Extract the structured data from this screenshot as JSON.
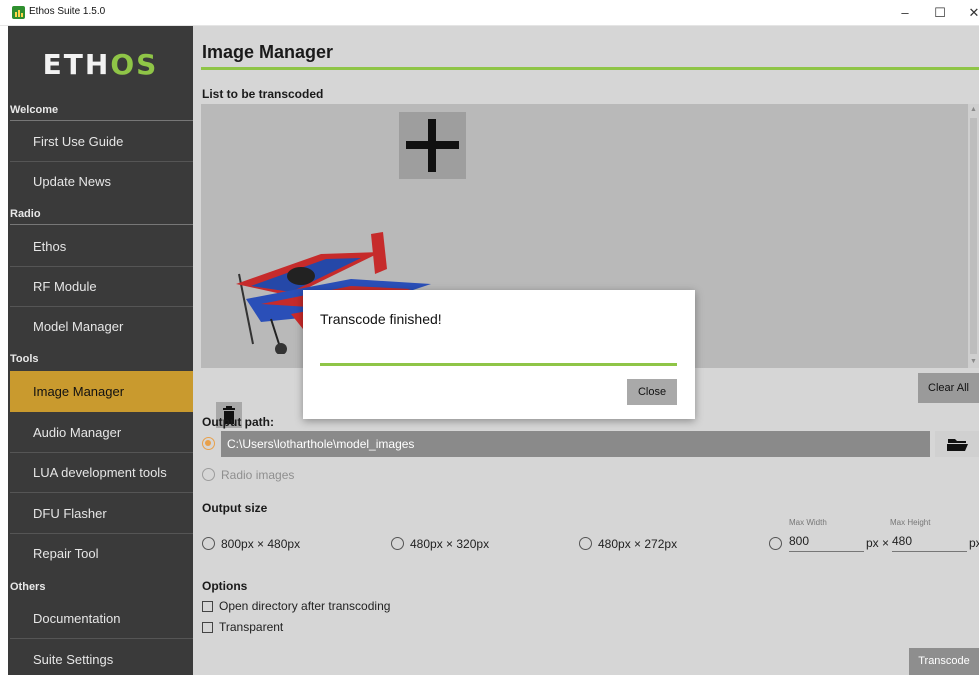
{
  "window": {
    "title": "Ethos Suite 1.5.0",
    "minimize_glyph": "–",
    "maximize_glyph": "☐",
    "close_glyph": "✕"
  },
  "sidebar": {
    "logo_main": "ETH",
    "logo_accent": "OS",
    "sections": {
      "welcome": "Welcome",
      "radio": "Radio",
      "tools": "Tools",
      "others": "Others"
    },
    "items": [
      {
        "label": "First Use Guide"
      },
      {
        "label": "Update News"
      },
      {
        "label": "Ethos"
      },
      {
        "label": "RF Module"
      },
      {
        "label": "Model Manager"
      },
      {
        "label": "Image Manager"
      },
      {
        "label": "Audio Manager"
      },
      {
        "label": "LUA development tools"
      },
      {
        "label": "DFU Flasher"
      },
      {
        "label": "Repair Tool"
      },
      {
        "label": "Documentation"
      },
      {
        "label": "Suite Settings"
      }
    ],
    "active_item": "Image Manager"
  },
  "main": {
    "title": "Image Manager",
    "list_label": "List to be transcoded",
    "clear_all_label": "Clear All",
    "output_path_label": "Output path:",
    "output_path_value": "C:\\Users\\lotharthole\\model_images",
    "radio_images_label": "Radio images",
    "output_size_label": "Output size",
    "sizes": [
      {
        "label": "800px × 480px"
      },
      {
        "label": "480px × 320px"
      },
      {
        "label": "480px × 272px"
      }
    ],
    "custom_size": {
      "max_width_label": "Max Width",
      "max_height_label": "Max Height",
      "width_value": "800",
      "height_value": "480",
      "px_times": "px ×",
      "px": "px"
    },
    "options_label": "Options",
    "options": [
      {
        "label": "Open directory after transcoding"
      },
      {
        "label": "Transparent"
      }
    ],
    "transcode_label": "Transcode"
  },
  "modal": {
    "message": "Transcode finished!",
    "progress": 1.0,
    "close_label": "Close"
  },
  "colors": {
    "accent_green": "#8fc547",
    "active_nav": "#c99a2e",
    "radio_checked": "#e8a04a"
  }
}
